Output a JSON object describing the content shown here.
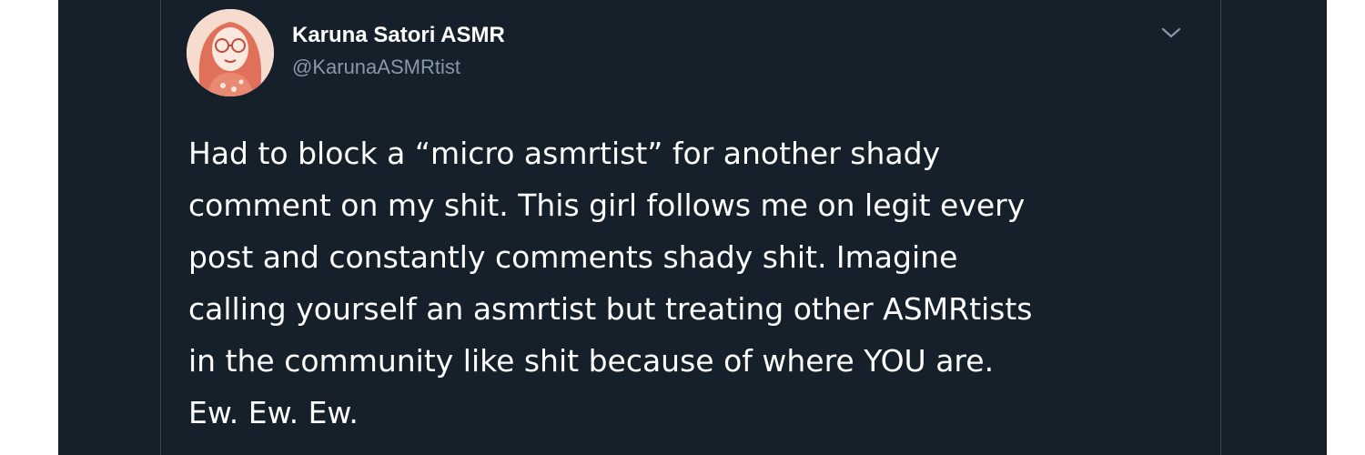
{
  "tweet": {
    "display_name": "Karuna Satori ASMR",
    "handle": "@KarunaASMRtist",
    "lines": [
      "Had to block a “micro asmrtist” for another shady",
      "comment on my shit. This girl follows me on legit every",
      "post and constantly comments shady shit. Imagine",
      "calling yourself an asmrtist but treating other ASMRtists",
      "in the community like shit because of where YOU are.",
      "Ew. Ew. Ew."
    ],
    "menu_icon": "chevron-down-icon",
    "avatar_icon": "illustrated-woman-avatar"
  },
  "colors": {
    "background": "#15202b",
    "text": "#ffffff",
    "secondary_text": "#8899a6",
    "avatar_accent": "#e0705a"
  }
}
